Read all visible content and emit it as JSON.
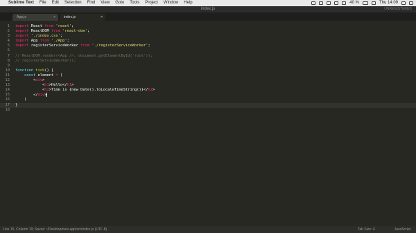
{
  "menubar": {
    "app": "Sublime Text",
    "items": [
      "File",
      "Edit",
      "Selection",
      "Find",
      "View",
      "Goto",
      "Tools",
      "Project",
      "Window",
      "Help"
    ],
    "battery": "40 %",
    "clock": "Thu 14:09"
  },
  "window": {
    "title": "index.js",
    "unregistered": "UNREGISTERED"
  },
  "tabs": [
    {
      "label": "App.js"
    },
    {
      "label": "index.js"
    }
  ],
  "editor": {
    "line_numbers": [
      "1",
      "2",
      "3",
      "4",
      "5",
      "6",
      "7",
      "8",
      "9",
      "10",
      "11",
      "12",
      "13",
      "14",
      "15",
      "16",
      "17",
      "18"
    ],
    "lines": {
      "l1a": "import",
      "l1b": " React ",
      "l1c": "from",
      "l1d": " 'react'",
      "l2a": "import",
      "l2b": " ReactDOM ",
      "l2c": "from",
      "l2d": " 'react-dom'",
      "l3a": "import",
      "l3d": " './index.css'",
      "l4a": "import",
      "l4b": " App ",
      "l4c": "from",
      "l4d": " './App'",
      "l5a": "import",
      "l5b": " registerServiceWorker ",
      "l5c": "from",
      "l5d": " './registerServiceWorker'",
      "l7": "// ReactDOM.render(<App />, document.getElementById('root'));",
      "l8": "// registerServiceWorker();",
      "l10a": "function",
      "l10b": " tick",
      "l10c": "() {",
      "l11a": "    const",
      "l11b": " element ",
      "l11c": "=",
      "l11d": " (",
      "l12a": "        <",
      "l12b": "div",
      "l12c": ">",
      "l13a": "            <",
      "l13b": "h1",
      "l13c": ">Hello</",
      "l13d": "h1",
      "l13e": ">",
      "l14a": "            <",
      "l14b": "h2",
      "l14c": ">Time is {new Date().toLocaleTimeString()}</",
      "l14d": "h2",
      "l14e": ">",
      "l15a": "        </",
      "l15b": "div",
      "l15c": ">",
      "l16": "    )",
      "l17": "}"
    }
  },
  "status": {
    "left": "Line 15, Column 19; Saved ~/Desktop/new-app/src/index.js (UTF-8)",
    "tab_size": "Tab Size: 4",
    "syntax": "JavaScript"
  }
}
